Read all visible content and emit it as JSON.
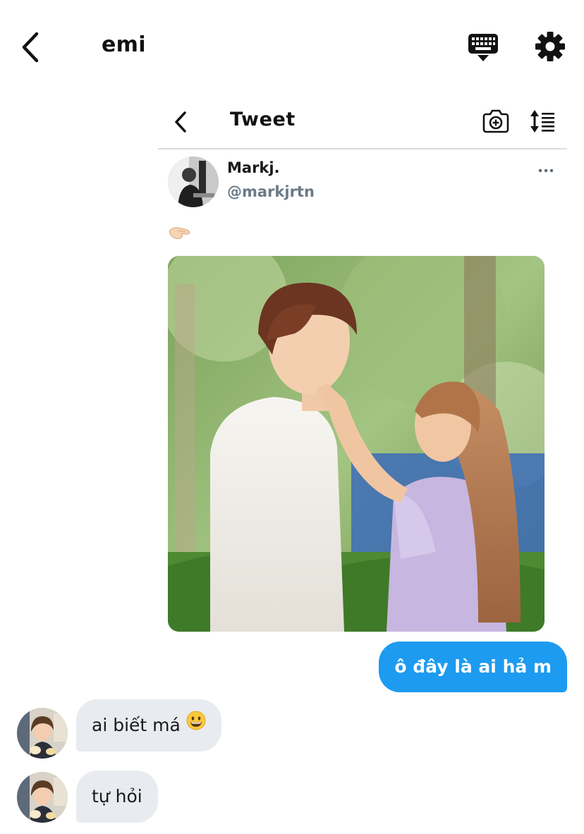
{
  "header": {
    "title": "emi",
    "back_icon": "chevron-left-icon",
    "keyboard_icon": "keyboard-icon",
    "settings_icon": "gear-icon"
  },
  "tweet": {
    "header_title": "Tweet",
    "author_name": "Markj.",
    "author_handle": "@markjrtn",
    "body_emoji": "pinching-hand-emoji",
    "media_alt": "photo",
    "more_icon": "more-dots-icon"
  },
  "messages": [
    {
      "direction": "outgoing",
      "text": "ô đây là ai hả m"
    },
    {
      "direction": "incoming",
      "text": "ai biết má",
      "emoji": "grinning-face-emoji"
    },
    {
      "direction": "incoming",
      "text": "tự hỏi"
    }
  ],
  "colors": {
    "outgoing_bubble": "#1d9bf0",
    "incoming_bubble": "#e8ecf0",
    "handle_gray": "#6b7a87"
  }
}
